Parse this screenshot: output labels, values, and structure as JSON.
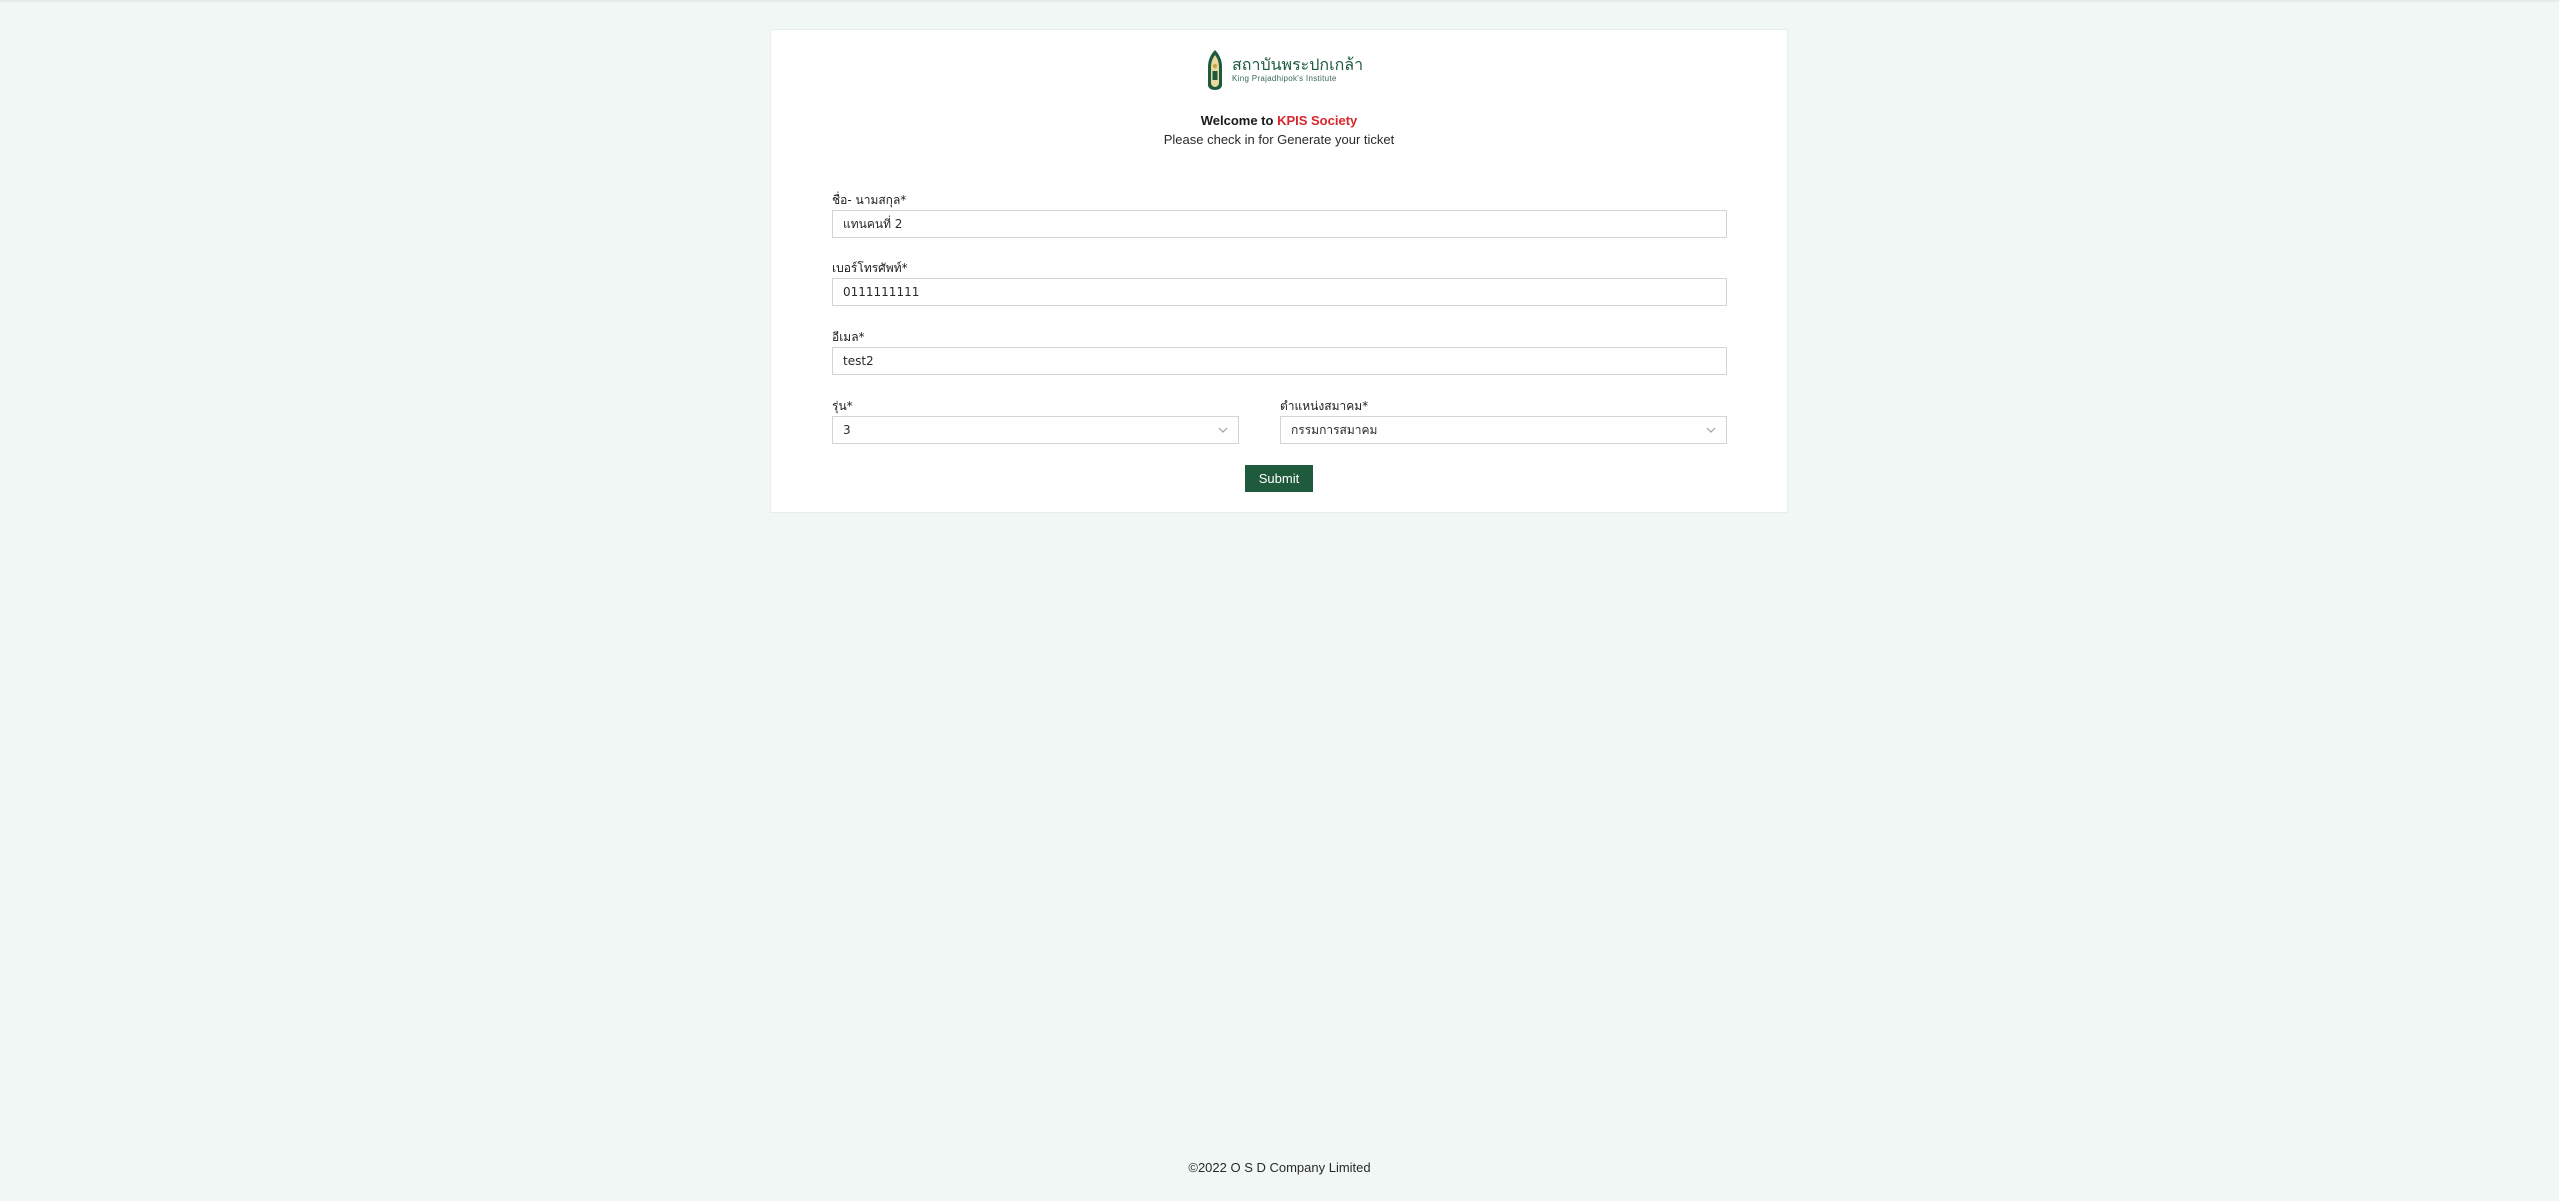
{
  "header": {
    "logo_thai": "สถาบันพระปกเกล้า",
    "logo_english": "King Prajadhipok's Institute",
    "welcome_prefix": "Welcome to ",
    "welcome_brand": "KPIS Society",
    "subtitle": "Please check in for Generate your ticket"
  },
  "form": {
    "name": {
      "label": "ชื่อ- นามสกุล*",
      "value": "แทนคนที่ 2"
    },
    "phone": {
      "label": "เบอร์โทรศัพท์*",
      "value": "0111111111"
    },
    "email": {
      "label": "อีเมล*",
      "value": "test2"
    },
    "generation": {
      "label": "รุ่น*",
      "value": "3",
      "icon": "chevron-down-icon"
    },
    "position": {
      "label": "ตำแหน่งสมาคม*",
      "value": "กรรมการสมาคม",
      "icon": "chevron-down-icon"
    },
    "submit_label": "Submit"
  },
  "footer": {
    "copyright": "©2022 O S D Company Limited"
  },
  "colors": {
    "page_background": "#f1f7f4",
    "brand_green": "#1f5a3c",
    "brand_red": "#d9262c"
  }
}
